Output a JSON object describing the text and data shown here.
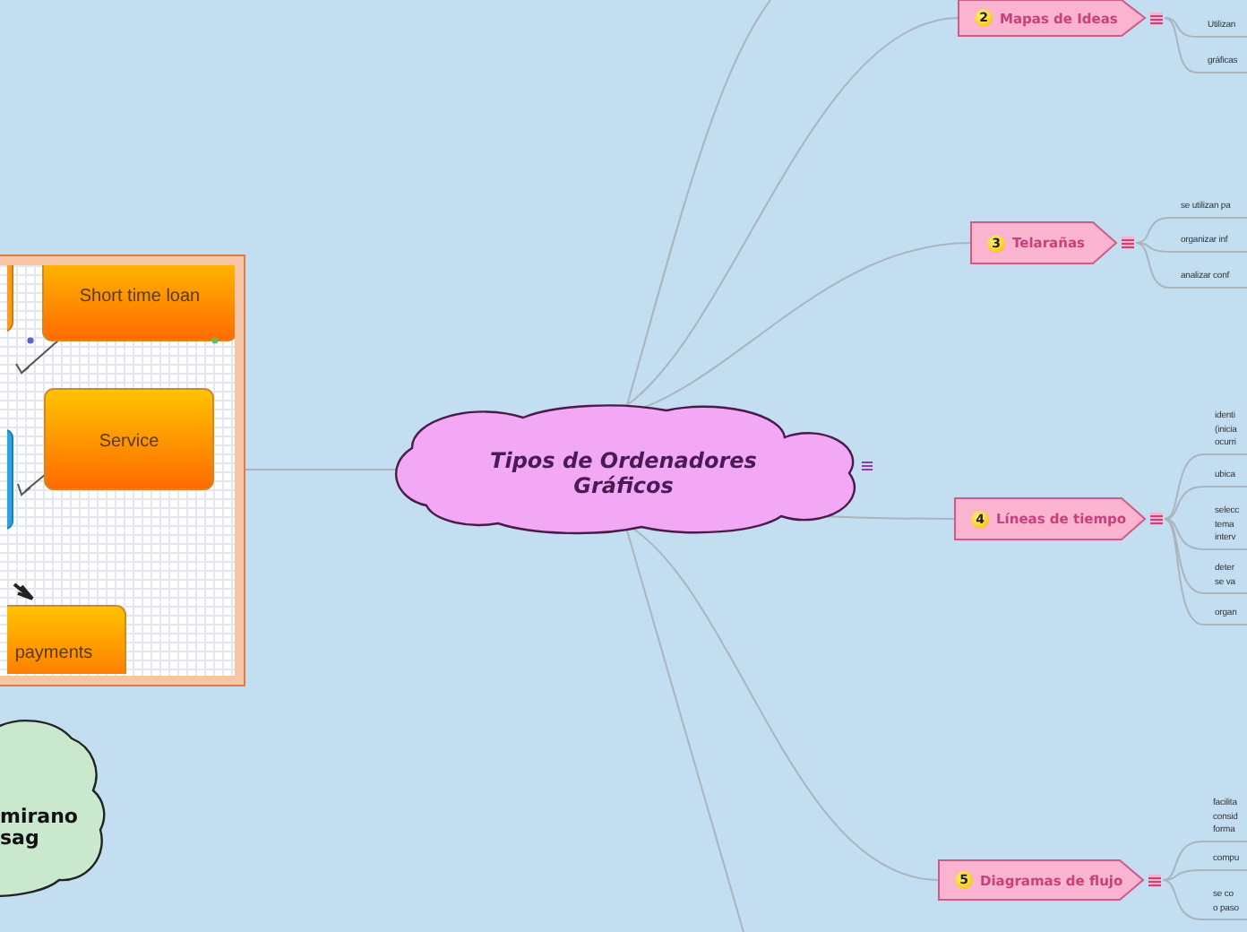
{
  "central_topic": {
    "title": "Tipos de Ordenadores Gráficos"
  },
  "topics": [
    {
      "number": "2",
      "label": "Mapas de Ideas",
      "subtopics": [
        {
          "lines": [
            "Utilizan"
          ]
        },
        {
          "lines": [
            "gráficas"
          ]
        }
      ]
    },
    {
      "number": "3",
      "label": "Telarañas",
      "subtopics": [
        {
          "lines": [
            "se utilizan pa"
          ]
        },
        {
          "lines": [
            "organizar inf"
          ]
        },
        {
          "lines": [
            "analizar conf"
          ]
        }
      ]
    },
    {
      "number": "4",
      "label": "Líneas de tiempo",
      "subtopics": [
        {
          "lines": [
            "identi",
            "(inicia",
            "ocurri"
          ]
        },
        {
          "lines": [
            "ubica"
          ]
        },
        {
          "lines": [
            "selecc",
            "tema",
            "interv"
          ]
        },
        {
          "lines": [
            "deter",
            "se va"
          ]
        },
        {
          "lines": [
            "organ"
          ]
        }
      ]
    },
    {
      "number": "5",
      "label": "Diagramas de flujo",
      "subtopics": [
        {
          "lines": [
            "facilita",
            "consid",
            "forma"
          ]
        },
        {
          "lines": [
            "compu"
          ]
        },
        {
          "lines": [
            "se co",
            "o paso"
          ]
        }
      ]
    }
  ],
  "image": {
    "boxes": [
      "Short time loan",
      "Service",
      "payments"
    ]
  },
  "side_topic": {
    "lines": [
      "mirano",
      "sag"
    ]
  }
}
